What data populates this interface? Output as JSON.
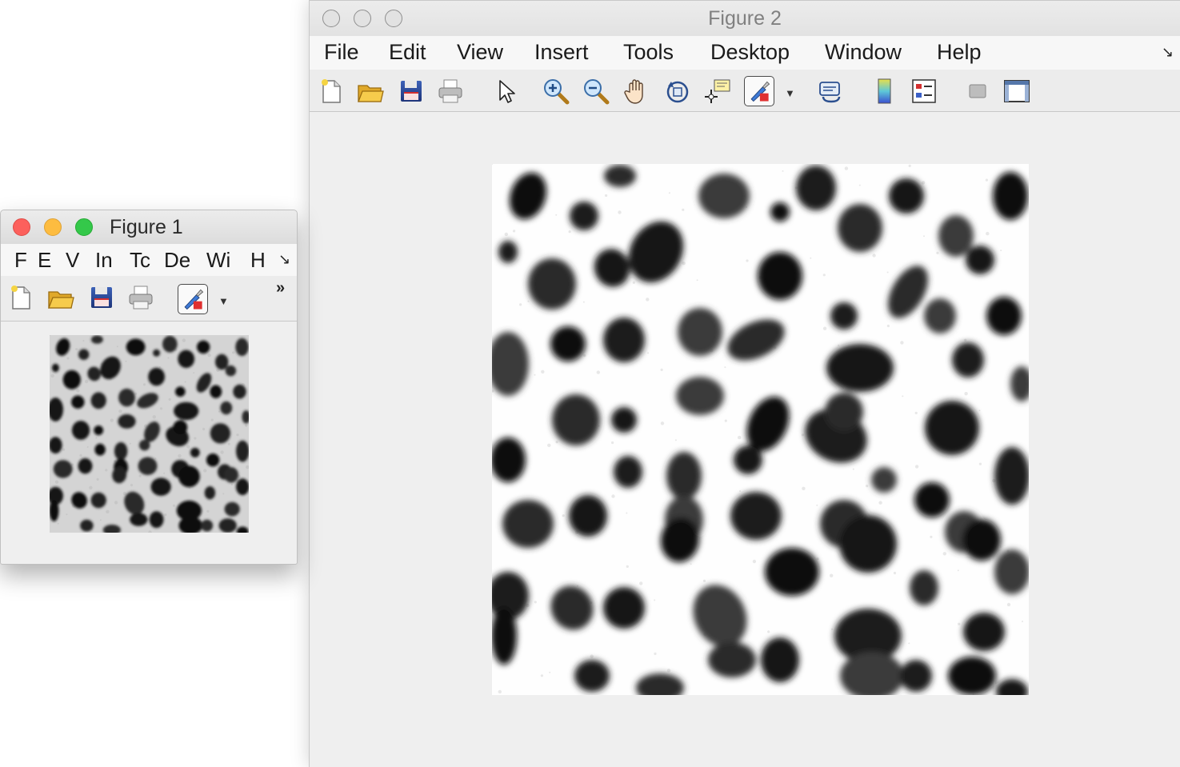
{
  "figure2": {
    "title": "Figure 2",
    "menu": [
      "File",
      "Edit",
      "View",
      "Insert",
      "Tools",
      "Desktop",
      "Window",
      "Help"
    ],
    "dock_arrow": "↘",
    "toolbar_icons": [
      "new-figure-icon",
      "open-file-icon",
      "save-icon",
      "print-icon",
      "pointer-icon",
      "zoom-in-icon",
      "zoom-out-icon",
      "pan-hand-icon",
      "rotate-3d-icon",
      "data-cursor-icon",
      "brush-icon",
      "link-plot-icon",
      "colorbar-icon",
      "legend-icon",
      "hide-plot-tools-icon",
      "show-plot-tools-icon"
    ],
    "image": "grayscale particle micrograph (enlarged)"
  },
  "figure1": {
    "title": "Figure 1",
    "menu": [
      "F",
      "E",
      "V",
      "In",
      "Tc",
      "De",
      "Wi",
      "H"
    ],
    "dock_arrow": "↘",
    "overflow": "»",
    "toolbar_icons": [
      "new-figure-icon",
      "open-file-icon",
      "save-icon",
      "print-icon",
      "brush-icon"
    ],
    "image": "grayscale particle micrograph"
  },
  "colors": {
    "window_bg": "#efefef",
    "close": "#fc605c",
    "minimize": "#fdbc40",
    "zoom": "#34c84a"
  }
}
